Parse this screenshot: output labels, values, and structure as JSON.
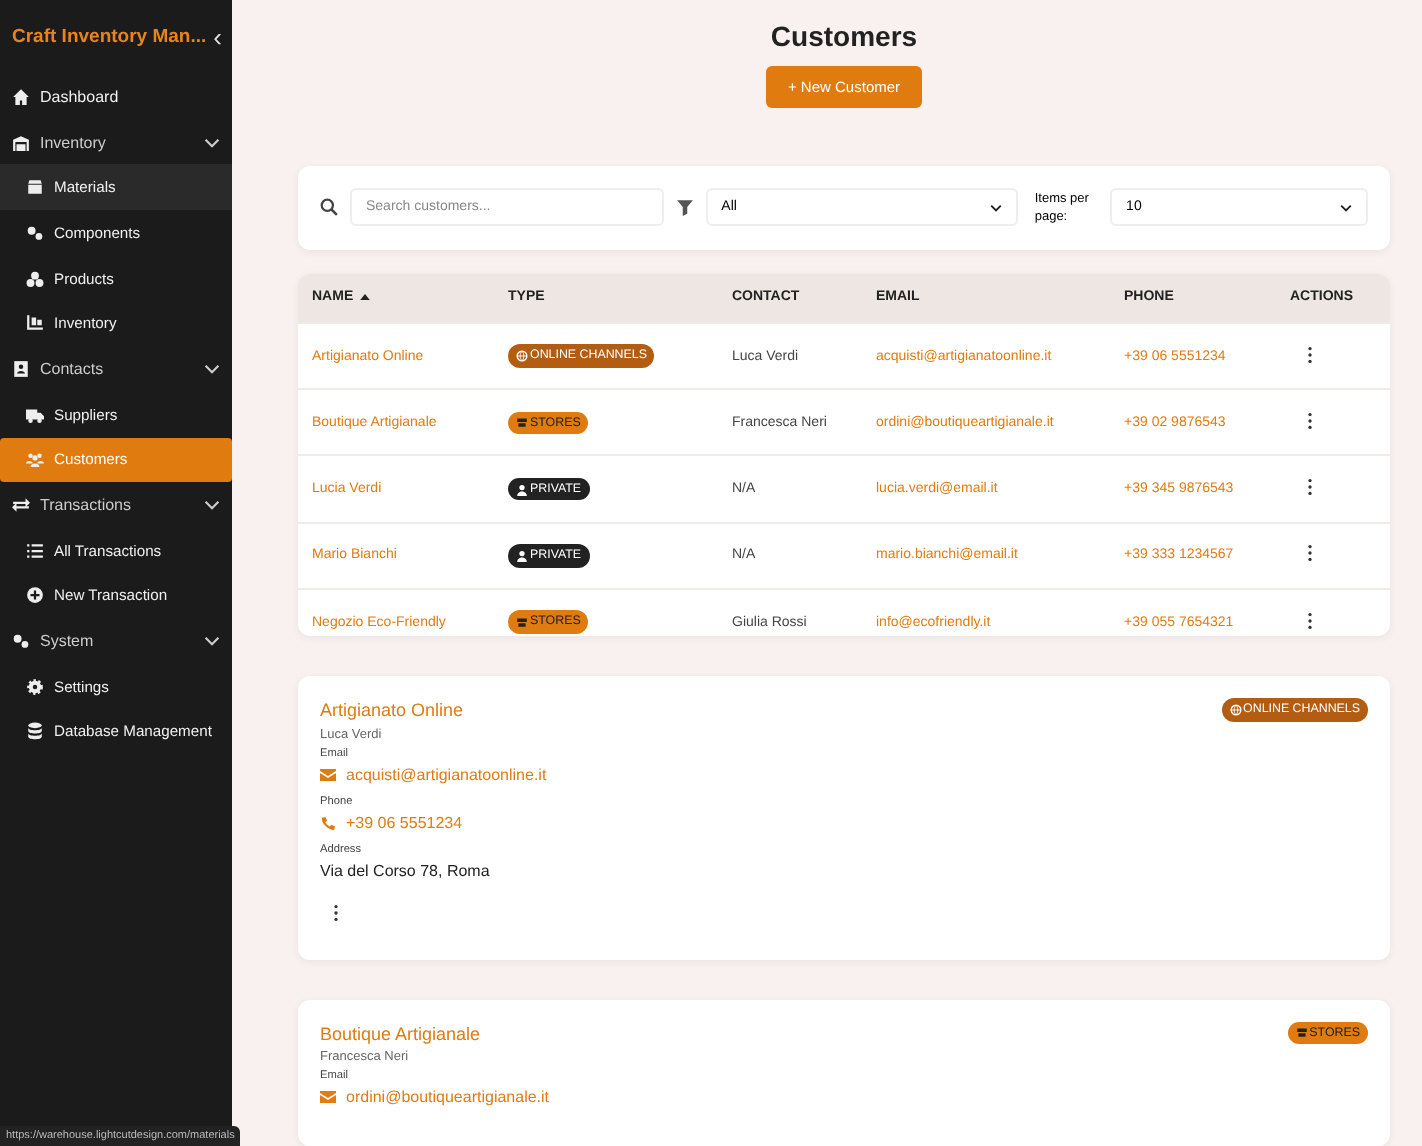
{
  "app_title": "Craft Inventory Man...",
  "collapse_icon": "‹",
  "nav": [
    {
      "label": "Dashboard",
      "kind": "home",
      "selected": false,
      "highlighted": false
    },
    {
      "label": "Inventory",
      "kind": "warehouse",
      "expanded": true,
      "children": [
        {
          "label": "Materials",
          "kind": "box",
          "selected": false,
          "highlighted": true
        },
        {
          "label": "Components",
          "kind": "gears",
          "selected": false,
          "highlighted": false
        },
        {
          "label": "Products",
          "kind": "shapes",
          "selected": false,
          "highlighted": false
        },
        {
          "label": "Inventory",
          "kind": "pallet",
          "selected": false,
          "highlighted": false
        }
      ]
    },
    {
      "label": "Contacts",
      "kind": "contact",
      "expanded": true,
      "children": [
        {
          "label": "Suppliers",
          "kind": "truck",
          "selected": false,
          "highlighted": false
        },
        {
          "label": "Customers",
          "kind": "users",
          "selected": true,
          "highlighted": false
        }
      ]
    },
    {
      "label": "Transactions",
      "kind": "arrows",
      "expanded": true,
      "children": [
        {
          "label": "All Transactions",
          "kind": "list",
          "selected": false,
          "highlighted": false
        },
        {
          "label": "New Transaction",
          "kind": "plus",
          "selected": false,
          "highlighted": false
        }
      ]
    },
    {
      "label": "System",
      "kind": "gears",
      "expanded": true,
      "children": [
        {
          "label": "Settings",
          "kind": "gear",
          "selected": false,
          "highlighted": false
        },
        {
          "label": "Database Management",
          "kind": "database",
          "selected": false,
          "highlighted": false
        }
      ]
    }
  ],
  "page_title": "Customers",
  "new_button": "+ New Customer",
  "filters": {
    "search_placeholder": "Search customers...",
    "type_value": "All",
    "per_page_label": "Items per page:",
    "per_page_value": "10"
  },
  "table": {
    "columns": [
      {
        "label": "NAME",
        "sorted": true
      },
      {
        "label": "TYPE",
        "sorted": false
      },
      {
        "label": "CONTACT",
        "sorted": false
      },
      {
        "label": "EMAIL",
        "sorted": false
      },
      {
        "label": "PHONE",
        "sorted": false
      },
      {
        "label": "ACTIONS",
        "sorted": false
      }
    ],
    "rows": [
      {
        "name": "Artigianato Online",
        "type": {
          "kind": "online",
          "label": "ONLINE CHANNELS"
        },
        "contact": "Luca Verdi",
        "email": "acquisti@artigianatoonline.it",
        "phone": "+39 06 5551234"
      },
      {
        "name": "Boutique Artigianale",
        "type": {
          "kind": "stores",
          "label": "STORES"
        },
        "contact": "Francesca Neri",
        "email": "ordini@boutiqueartigianale.it",
        "phone": "+39 02 9876543"
      },
      {
        "name": "Lucia Verdi",
        "type": {
          "kind": "private",
          "label": "PRIVATE"
        },
        "contact": "N/A",
        "email": "lucia.verdi@email.it",
        "phone": "+39 345 9876543"
      },
      {
        "name": "Mario Bianchi",
        "type": {
          "kind": "private",
          "label": "PRIVATE"
        },
        "contact": "N/A",
        "email": "mario.bianchi@email.it",
        "phone": "+39 333 1234567"
      },
      {
        "name": "Negozio Eco-Friendly",
        "type": {
          "kind": "stores",
          "label": "STORES"
        },
        "contact": "Giulia Rossi",
        "email": "info@ecofriendly.it",
        "phone": "+39 055 7654321"
      }
    ]
  },
  "cards": [
    {
      "name": "Artigianato Online",
      "type": {
        "kind": "online",
        "label": "ONLINE CHANNELS"
      },
      "contact": "Luca Verdi",
      "fields": [
        {
          "kind": "email",
          "label": "Email",
          "value": "acquisti@artigianatoonline.it"
        },
        {
          "kind": "phone",
          "label": "Phone",
          "value": "+39 06 5551234"
        },
        {
          "kind": "address",
          "label": "Address",
          "value": "Via del Corso 78, Roma"
        }
      ],
      "actions": true
    },
    {
      "name": "Boutique Artigianale",
      "type": {
        "kind": "stores",
        "label": "STORES"
      },
      "contact": "Francesca Neri",
      "fields": [
        {
          "kind": "email",
          "label": "Email",
          "value": "ordini@boutiqueartigianale.it"
        }
      ],
      "actions": false
    }
  ],
  "status_url": "https://warehouse.lightcutdesign.com/materials"
}
